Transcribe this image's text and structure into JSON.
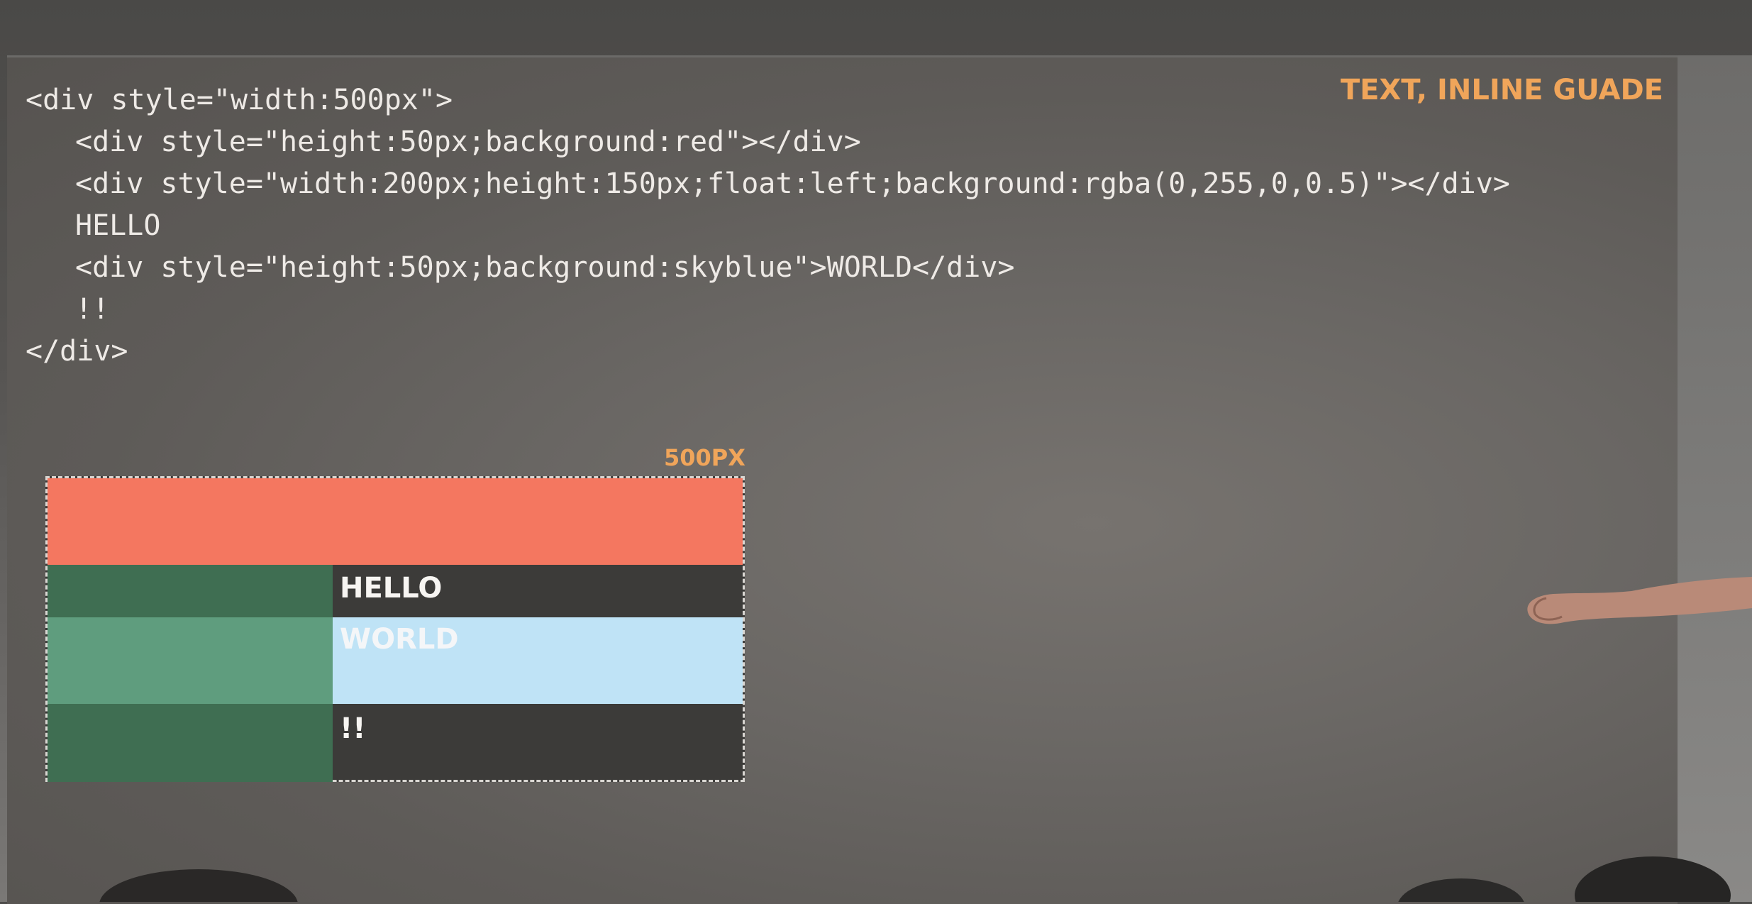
{
  "slide": {
    "title": "TEXT, INLINE GUADE",
    "code_lines": [
      "<div style=\"width:500px\">",
      "<div style=\"height:50px;background:red\"></div>",
      "<div style=\"width:200px;height:150px;float:left;background:rgba(0,255,0,0.5)\"></div>",
      "HELLO",
      "<div style=\"height:50px;background:skyblue\">WORLD</div>",
      "!!",
      "</div>"
    ],
    "demo": {
      "width_label": "500PX",
      "hello": "HELLO",
      "world": "WORLD",
      "bang": "!!"
    }
  },
  "colors": {
    "accent": "#f0a55a",
    "red_block": "#f47760",
    "float_block": "#3f6e52",
    "sky_block": "#bfe3f6",
    "code_text": "#eeeae6"
  }
}
